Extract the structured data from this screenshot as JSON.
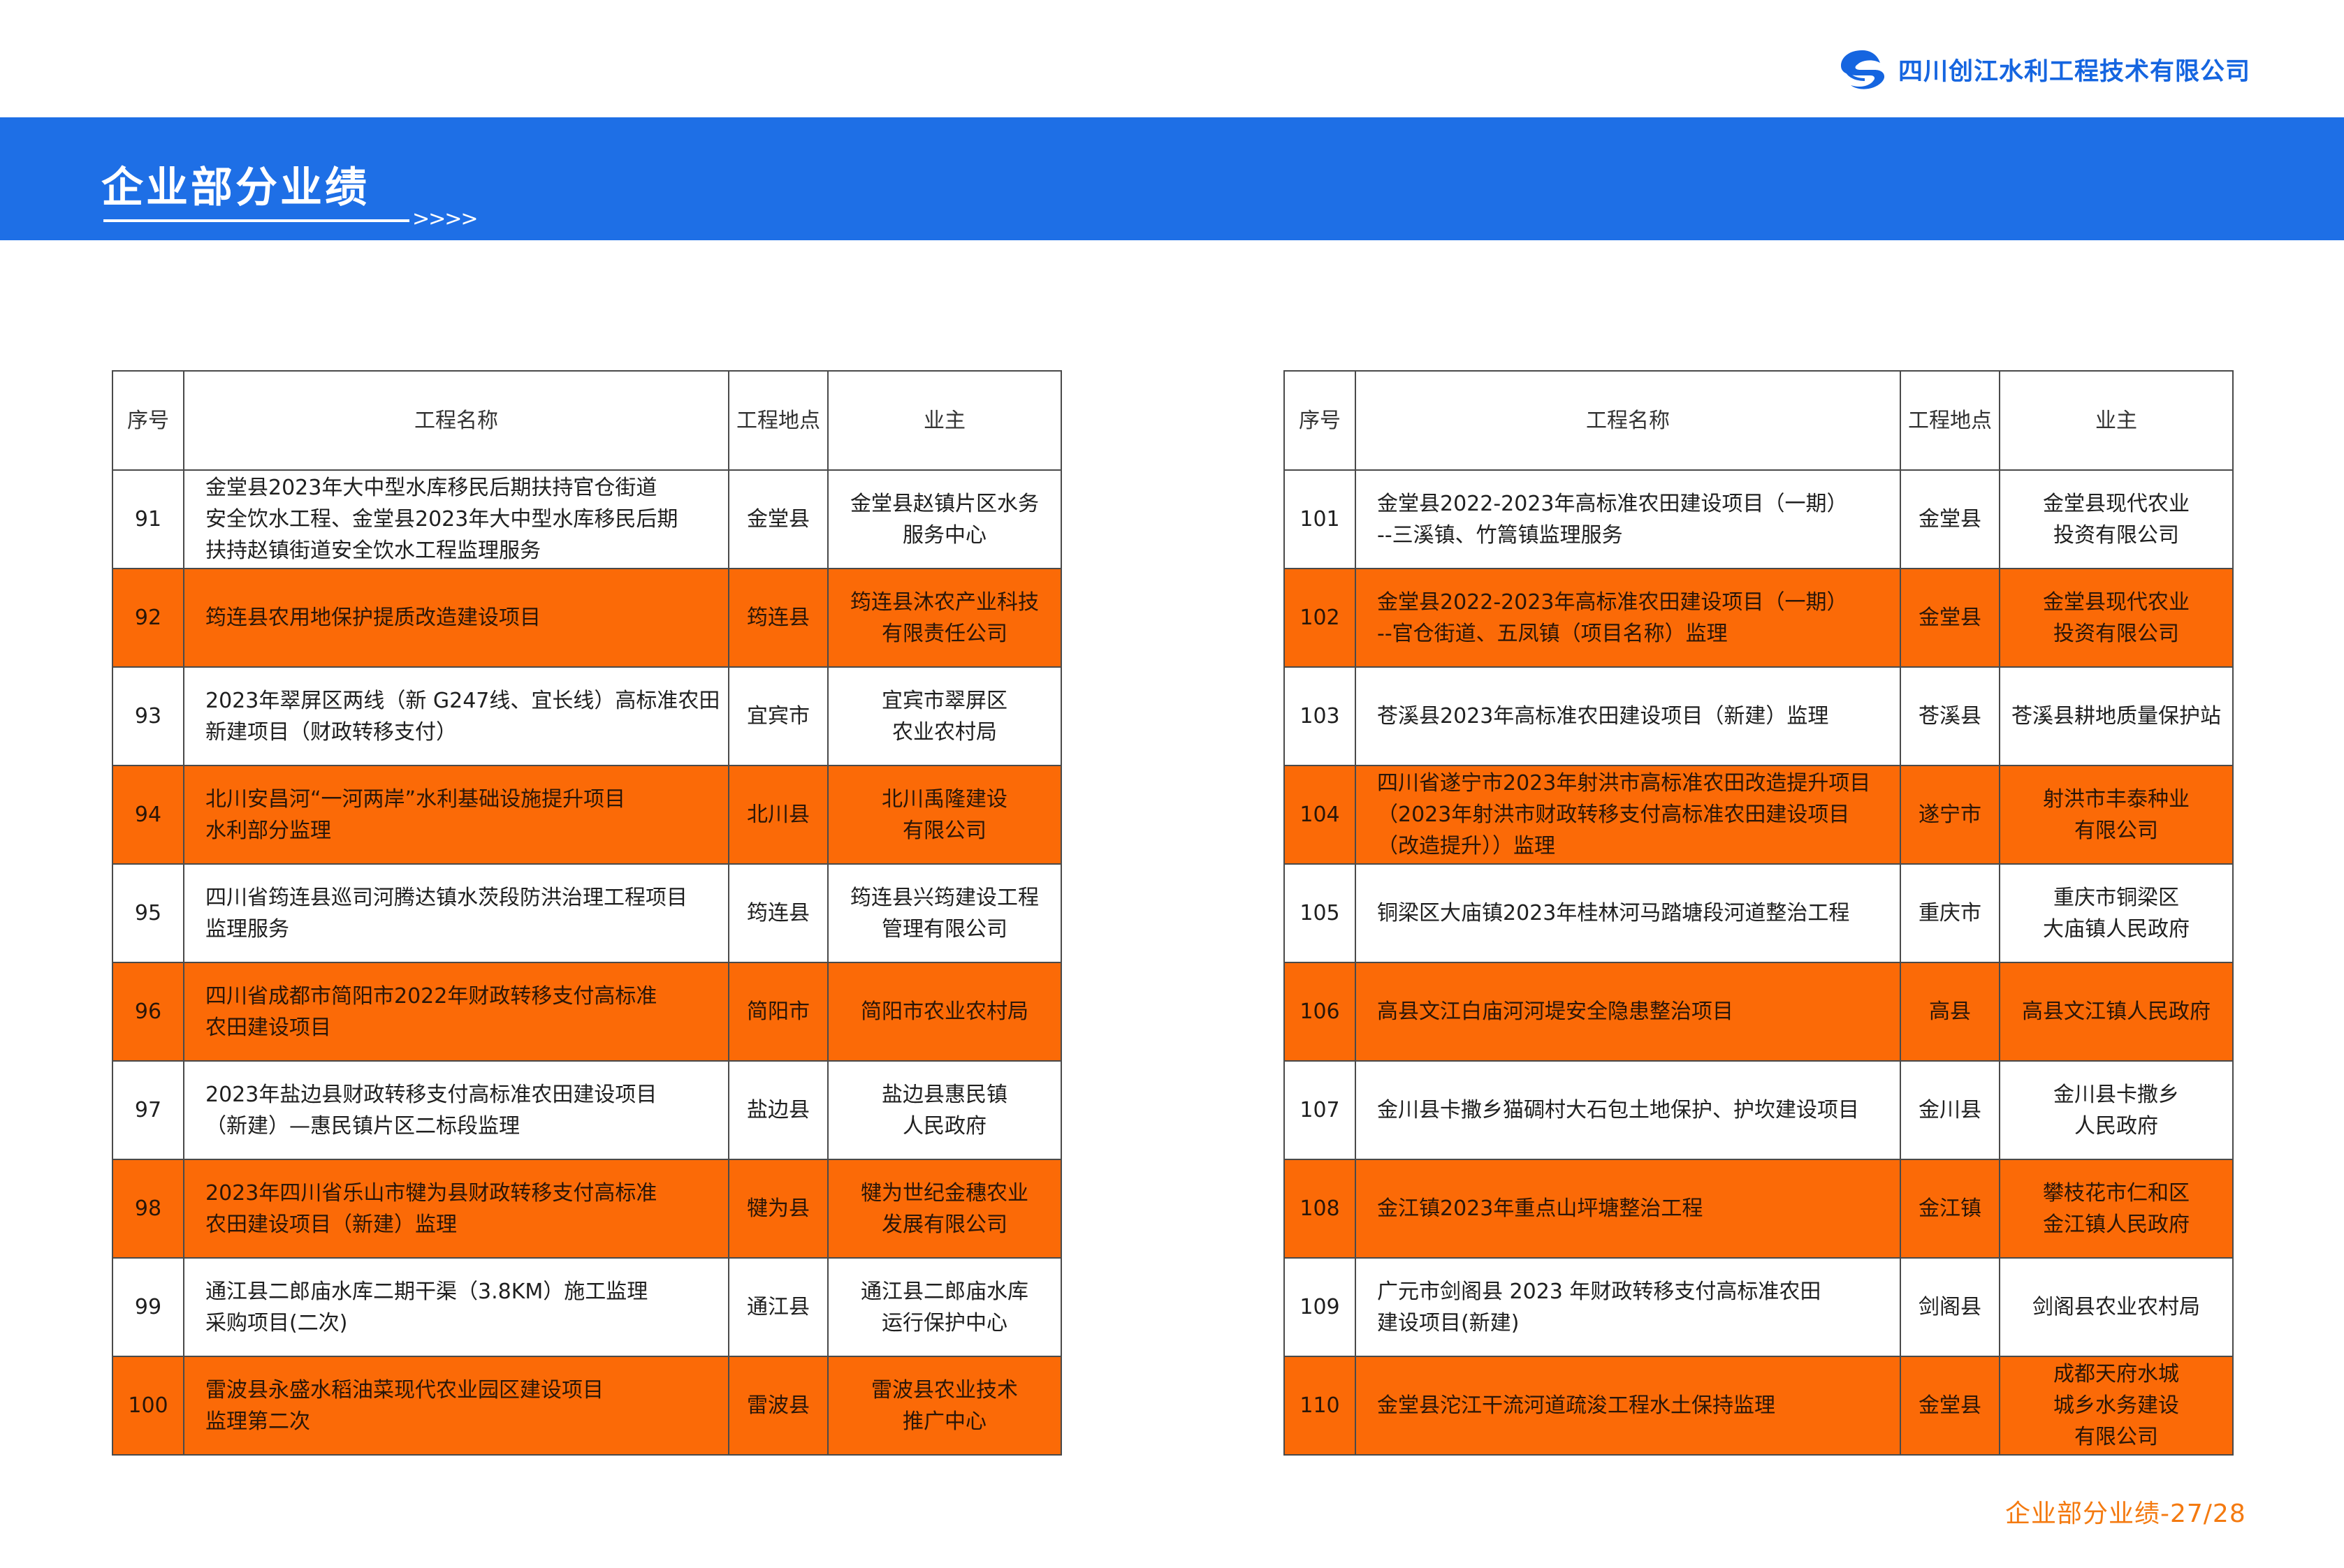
{
  "header": {
    "company_name": "四川创江水利工程技术有限公司",
    "logo_icon": "company-logo-icon",
    "banner_title": "企业部分业绩",
    "banner_arrows": ">>>>",
    "brand_color": "#1e6fe6",
    "accent_color": "#fb6a07"
  },
  "table_columns": {
    "number": "序号",
    "project_name": "工程名称",
    "location": "工程地点",
    "owner": "业主"
  },
  "left_table": {
    "rows": [
      {
        "no": "91",
        "name": "金堂县2023年大中型水库移民后期扶持官仓街道\n安全饮水工程、金堂县2023年大中型水库移民后期\n扶持赵镇街道安全饮水工程监理服务",
        "location": "金堂县",
        "owner": "金堂县赵镇片区水务\n服务中心",
        "highlighted": false
      },
      {
        "no": "92",
        "name": "筠连县农用地保护提质改造建设项目",
        "location": "筠连县",
        "owner": "筠连县沐农产业科技\n有限责任公司",
        "highlighted": true
      },
      {
        "no": "93",
        "name": "2023年翠屏区两线（新 G247线、宜长线）高标准农田\n新建项目（财政转移支付）",
        "location": "宜宾市",
        "owner": "宜宾市翠屏区\n农业农村局",
        "highlighted": false
      },
      {
        "no": "94",
        "name": "北川安昌河“一河两岸”水利基础设施提升项目\n水利部分监理",
        "location": "北川县",
        "owner": "北川禹隆建设\n有限公司",
        "highlighted": true
      },
      {
        "no": "95",
        "name": "四川省筠连县巡司河腾达镇水茨段防洪治理工程项目\n监理服务",
        "location": "筠连县",
        "owner": "筠连县兴筠建设工程\n管理有限公司",
        "highlighted": false
      },
      {
        "no": "96",
        "name": "四川省成都市简阳市2022年财政转移支付高标准\n农田建设项目",
        "location": "简阳市",
        "owner": "简阳市农业农村局",
        "highlighted": true
      },
      {
        "no": "97",
        "name": "2023年盐边县财政转移支付高标准农田建设项目\n（新建）—惠民镇片区二标段监理",
        "location": "盐边县",
        "owner": "盐边县惠民镇\n人民政府",
        "highlighted": false
      },
      {
        "no": "98",
        "name": "2023年四川省乐山市犍为县财政转移支付高标准\n农田建设项目（新建）监理",
        "location": "犍为县",
        "owner": "犍为世纪金穗农业\n发展有限公司",
        "highlighted": true
      },
      {
        "no": "99",
        "name": "通江县二郎庙水库二期干渠（3.8KM）施工监理\n采购项目(二次)",
        "location": "通江县",
        "owner": "通江县二郎庙水库\n运行保护中心",
        "highlighted": false
      },
      {
        "no": "100",
        "name": "雷波县永盛水稻油菜现代农业园区建设项目\n监理第二次",
        "location": "雷波县",
        "owner": "雷波县农业技术\n推广中心",
        "highlighted": true
      }
    ]
  },
  "right_table": {
    "rows": [
      {
        "no": "101",
        "name": "金堂县2022-2023年高标准农田建设项目（一期）\n--三溪镇、竹篙镇监理服务",
        "location": "金堂县",
        "owner": "金堂县现代农业\n投资有限公司",
        "highlighted": false
      },
      {
        "no": "102",
        "name": "金堂县2022-2023年高标准农田建设项目（一期）\n--官仓街道、五凤镇（项目名称）监理",
        "location": "金堂县",
        "owner": "金堂县现代农业\n投资有限公司",
        "highlighted": true
      },
      {
        "no": "103",
        "name": "苍溪县2023年高标准农田建设项目（新建）监理",
        "location": "苍溪县",
        "owner": "苍溪县耕地质量保护站",
        "highlighted": false
      },
      {
        "no": "104",
        "name": "四川省遂宁市2023年射洪市高标准农田改造提升项目\n（2023年射洪市财政转移支付高标准农田建设项目\n（改造提升））监理",
        "location": "遂宁市",
        "owner": "射洪市丰泰种业\n有限公司",
        "highlighted": true
      },
      {
        "no": "105",
        "name": "铜梁区大庙镇2023年桂林河马踏塘段河道整治工程",
        "location": "重庆市",
        "owner": "重庆市铜梁区\n大庙镇人民政府",
        "highlighted": false
      },
      {
        "no": "106",
        "name": "高县文江白庙河河堤安全隐患整治项目",
        "location": "高县",
        "owner": "高县文江镇人民政府",
        "highlighted": true
      },
      {
        "no": "107",
        "name": "金川县卡撒乡猫碉村大石包土地保护、护坎建设项目",
        "location": "金川县",
        "owner": "金川县卡撒乡\n人民政府",
        "highlighted": false
      },
      {
        "no": "108",
        "name": "金江镇2023年重点山坪塘整治工程",
        "location": "金江镇",
        "owner": "攀枝花市仁和区\n金江镇人民政府",
        "highlighted": true
      },
      {
        "no": "109",
        "name": "广元市剑阁县 2023 年财政转移支付高标准农田\n建设项目(新建)",
        "location": "剑阁县",
        "owner": "剑阁县农业农村局",
        "highlighted": false
      },
      {
        "no": "110",
        "name": "金堂县沱江干流河道疏浚工程水土保持监理",
        "location": "金堂县",
        "owner": "成都天府水城\n城乡水务建设\n有限公司",
        "highlighted": true
      }
    ]
  },
  "footer": {
    "page_label": "企业部分业绩-27/28"
  }
}
